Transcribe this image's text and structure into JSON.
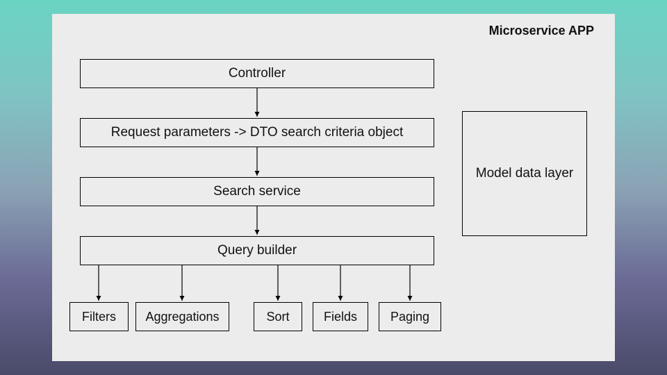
{
  "title": "Microservice APP",
  "boxes": {
    "controller": "Controller",
    "dto": "Request parameters -> DTO search criteria object",
    "search_service": "Search service",
    "query_builder": "Query builder",
    "filters": "Filters",
    "aggregations": "Aggregations",
    "sort": "Sort",
    "fields": "Fields",
    "paging": "Paging",
    "model": "Model data layer"
  }
}
